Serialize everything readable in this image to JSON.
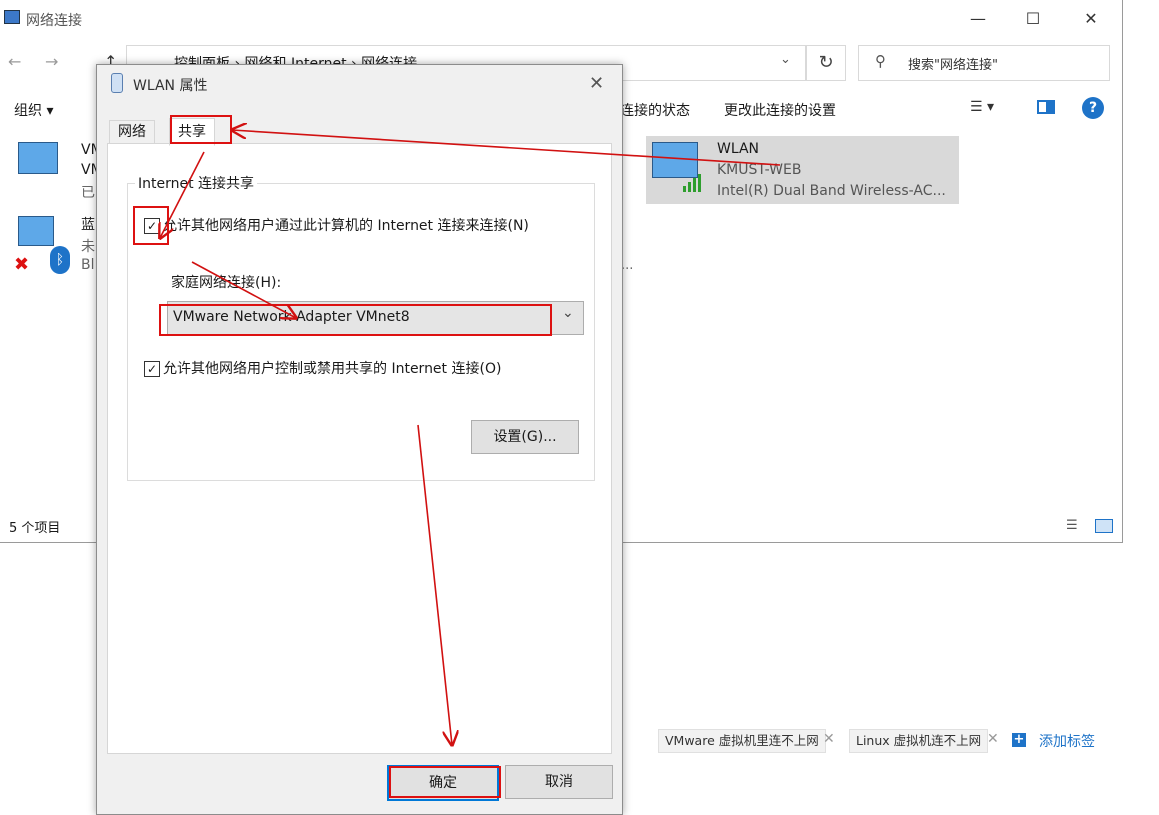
{
  "explorer": {
    "title": "网络连接",
    "breadcrumb": [
      "控制面板",
      "网络和 Internet",
      "网络连接"
    ],
    "search_placeholder": "搜索\"网络连接\"",
    "toolbar": {
      "organize": "组织 ▾",
      "view_status": "连接的状态",
      "change_settings": "更改此连接的设置"
    },
    "connections": [
      {
        "line1": "VM",
        "line2": "VM",
        "line3": "已"
      },
      {
        "line1": "蓝",
        "line2": "未",
        "line3": "Bl"
      }
    ],
    "wlan_tile": {
      "name": "WLAN",
      "network": "KMUST-WEB",
      "adapter": "Intel(R) Dual Band Wireless-AC..."
    },
    "status": "5 个项目",
    "ellipsis": "..."
  },
  "tags": {
    "items": [
      "VMware 虚拟机里连不上网",
      "Linux 虚拟机连不上网"
    ],
    "add_label": "添加标签"
  },
  "dialog": {
    "title": "WLAN 属性",
    "tabs": [
      "网络",
      "共享"
    ],
    "group_title": "Internet 连接共享",
    "allow_share_label": "允许其他网络用户通过此计算机的 Internet 连接来连接(N)",
    "allow_share_checked": true,
    "home_label": "家庭网络连接(H):",
    "home_value": "VMware Network Adapter VMnet8",
    "allow_control_label": "允许其他网络用户控制或禁用共享的 Internet 连接(O)",
    "allow_control_checked": true,
    "settings_btn": "设置(G)...",
    "ok_btn": "确定",
    "cancel_btn": "取消"
  },
  "colors": {
    "annotation": "#d11111",
    "accent": "#1e73c8"
  }
}
